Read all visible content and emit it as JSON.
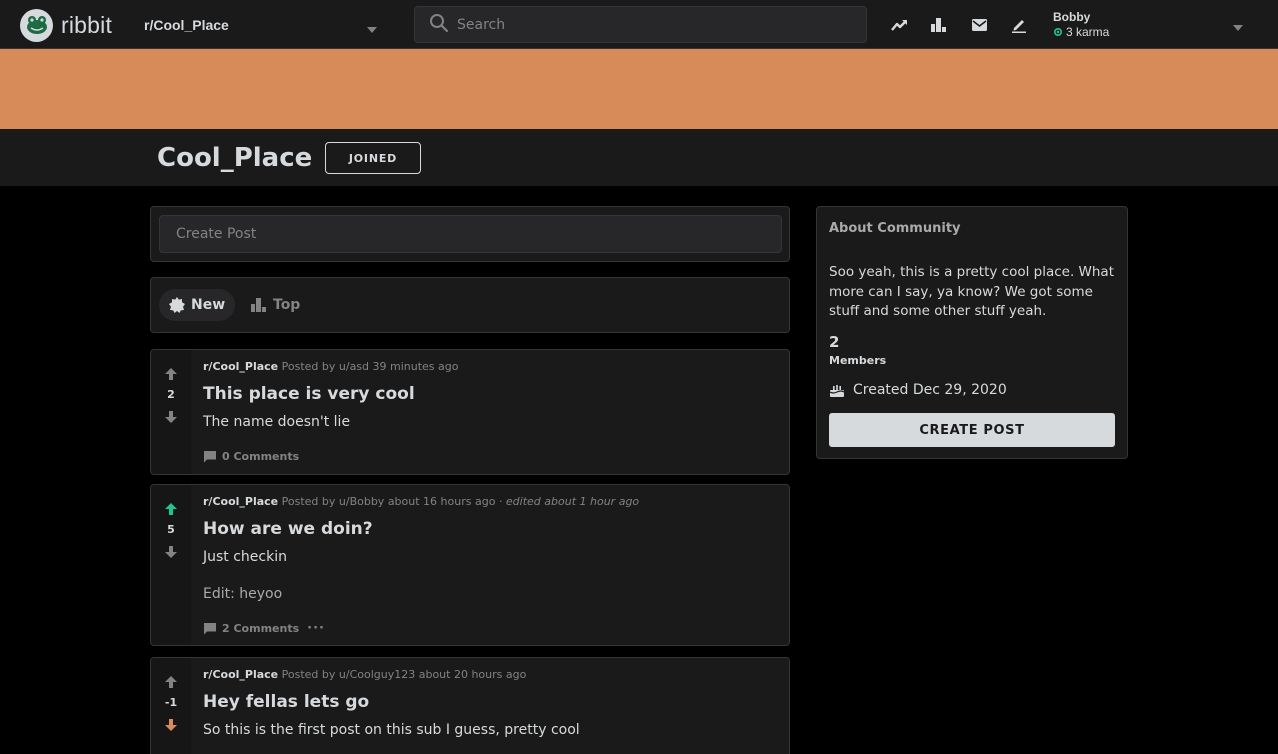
{
  "topbar": {
    "brand": "ribbit",
    "subreddit_selector": "r/Cool_Place",
    "search_placeholder": "Search",
    "user": {
      "name": "Bobby",
      "karma": "3 karma"
    }
  },
  "colors": {
    "banner": "#d68b59",
    "upvoted": "#1fc68e",
    "downvoted": "#d88a5a",
    "karma_icon": "#1fc68e"
  },
  "community": {
    "name": "Cool_Place",
    "join_label": "JOINED"
  },
  "create_post": {
    "placeholder": "Create Post"
  },
  "sort": {
    "new_label": "New",
    "top_label": "Top"
  },
  "posts": [
    {
      "subreddit": "r/Cool_Place",
      "byline": "Posted by u/asd 39 minutes ago",
      "edited": "",
      "title": "This place is very cool",
      "body": "The name doesn't lie",
      "body_extra": "",
      "score": "2",
      "vote": "none",
      "comments": "0 Comments"
    },
    {
      "subreddit": "r/Cool_Place",
      "byline": "Posted by u/Bobby about 16 hours ago",
      "edited": "· edited about 1 hour ago",
      "title": "How are we doin?",
      "body": "Just checkin",
      "body_extra": "Edit: heyoo",
      "score": "5",
      "vote": "up",
      "comments": "2 Comments",
      "more": "···"
    },
    {
      "subreddit": "r/Cool_Place",
      "byline": "Posted by u/Coolguy123 about 20 hours ago",
      "edited": "",
      "title": "Hey fellas lets go",
      "body": "So this is the first post on this sub I guess, pretty cool",
      "body_extra": "",
      "score": "-1",
      "vote": "down",
      "comments": ""
    }
  ],
  "about": {
    "title": "About Community",
    "description": "Soo yeah, this is a pretty cool place. What more can I say, ya know? We got some stuff and some other stuff yeah.",
    "members_count": "2",
    "members_label": "Members",
    "created": "Created Dec 29, 2020",
    "create_post_button": "CREATE POST"
  }
}
